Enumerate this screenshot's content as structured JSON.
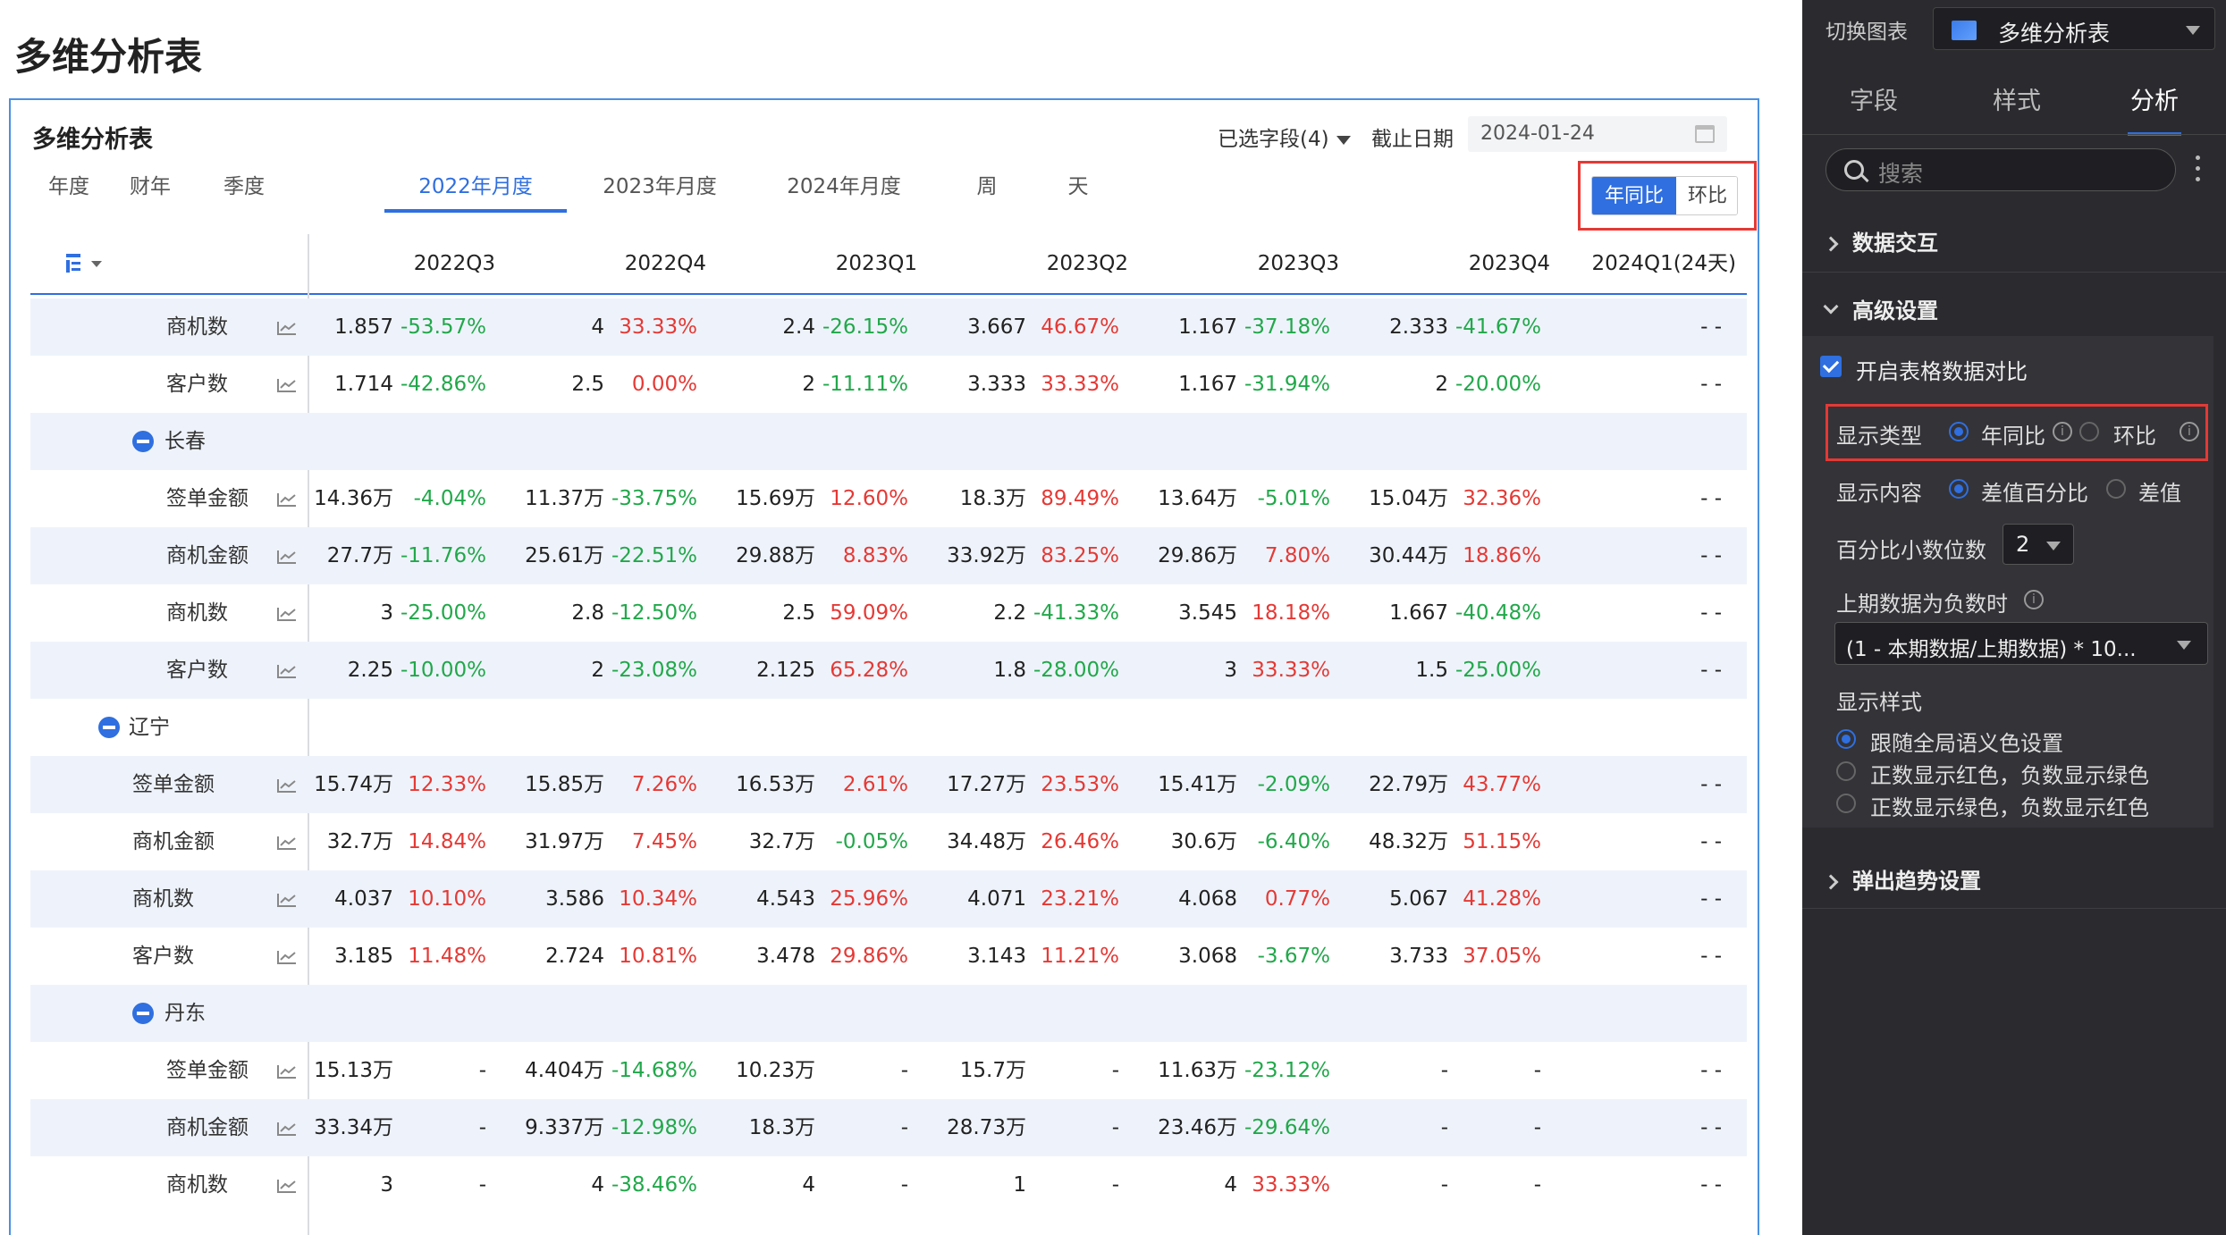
{
  "page_title": "多维分析表",
  "card": {
    "title": "多维分析表",
    "field_select": "已选字段(4)",
    "cutoff_label": "截止日期",
    "cutoff_date": "2024-01-24",
    "tabs": [
      "年度",
      "财年",
      "季度",
      "2022年月度",
      "2023年月度",
      "2024年月度",
      "周",
      "天"
    ],
    "active_tab": "2022年月度",
    "toggle": {
      "yoy": "年同比",
      "mom": "环比",
      "selected": "年同比"
    }
  },
  "table": {
    "columns": [
      "2022Q3",
      "2022Q4",
      "2023Q1",
      "2023Q2",
      "2023Q3",
      "2023Q4",
      "2024Q1(24天)"
    ],
    "rows": [
      {
        "kind": "metric",
        "indent": 1,
        "label": "商机数",
        "cells": [
          [
            "1.857",
            "-53.57%"
          ],
          [
            "4",
            "33.33%"
          ],
          [
            "2.4",
            "-26.15%"
          ],
          [
            "3.667",
            "46.67%"
          ],
          [
            "1.167",
            "-37.18%"
          ],
          [
            "2.333",
            "-41.67%"
          ],
          [
            "- -",
            ""
          ]
        ]
      },
      {
        "kind": "metric",
        "indent": 1,
        "label": "客户数",
        "cells": [
          [
            "1.714",
            "-42.86%"
          ],
          [
            "2.5",
            "0.00%"
          ],
          [
            "2",
            "-11.11%"
          ],
          [
            "3.333",
            "33.33%"
          ],
          [
            "1.167",
            "-31.94%"
          ],
          [
            "2",
            "-20.00%"
          ],
          [
            "- -",
            ""
          ]
        ]
      },
      {
        "kind": "group",
        "indent": 1,
        "label": "长春"
      },
      {
        "kind": "metric",
        "indent": 1,
        "label": "签单金额",
        "cells": [
          [
            "14.36万",
            "-4.04%"
          ],
          [
            "11.37万",
            "-33.75%"
          ],
          [
            "15.69万",
            "12.60%"
          ],
          [
            "18.3万",
            "89.49%"
          ],
          [
            "13.64万",
            "-5.01%"
          ],
          [
            "15.04万",
            "32.36%"
          ],
          [
            "- -",
            ""
          ]
        ]
      },
      {
        "kind": "metric",
        "indent": 1,
        "label": "商机金额",
        "cells": [
          [
            "27.7万",
            "-11.76%"
          ],
          [
            "25.61万",
            "-22.51%"
          ],
          [
            "29.88万",
            "8.83%"
          ],
          [
            "33.92万",
            "83.25%"
          ],
          [
            "29.86万",
            "7.80%"
          ],
          [
            "30.44万",
            "18.86%"
          ],
          [
            "- -",
            ""
          ]
        ]
      },
      {
        "kind": "metric",
        "indent": 1,
        "label": "商机数",
        "cells": [
          [
            "3",
            "-25.00%"
          ],
          [
            "2.8",
            "-12.50%"
          ],
          [
            "2.5",
            "59.09%"
          ],
          [
            "2.2",
            "-41.33%"
          ],
          [
            "3.545",
            "18.18%"
          ],
          [
            "1.667",
            "-40.48%"
          ],
          [
            "- -",
            ""
          ]
        ]
      },
      {
        "kind": "metric",
        "indent": 1,
        "label": "客户数",
        "cells": [
          [
            "2.25",
            "-10.00%"
          ],
          [
            "2",
            "-23.08%"
          ],
          [
            "2.125",
            "65.28%"
          ],
          [
            "1.8",
            "-28.00%"
          ],
          [
            "3",
            "33.33%"
          ],
          [
            "1.5",
            "-25.00%"
          ],
          [
            "- -",
            ""
          ]
        ]
      },
      {
        "kind": "group",
        "indent": 0,
        "label": "辽宁"
      },
      {
        "kind": "metric",
        "indent": 0,
        "label": "签单金额",
        "cells": [
          [
            "15.74万",
            "12.33%"
          ],
          [
            "15.85万",
            "7.26%"
          ],
          [
            "16.53万",
            "2.61%"
          ],
          [
            "17.27万",
            "23.53%"
          ],
          [
            "15.41万",
            "-2.09%"
          ],
          [
            "22.79万",
            "43.77%"
          ],
          [
            "- -",
            ""
          ]
        ]
      },
      {
        "kind": "metric",
        "indent": 0,
        "label": "商机金额",
        "cells": [
          [
            "32.7万",
            "14.84%"
          ],
          [
            "31.97万",
            "7.45%"
          ],
          [
            "32.7万",
            "-0.05%"
          ],
          [
            "34.48万",
            "26.46%"
          ],
          [
            "30.6万",
            "-6.40%"
          ],
          [
            "48.32万",
            "51.15%"
          ],
          [
            "- -",
            ""
          ]
        ]
      },
      {
        "kind": "metric",
        "indent": 0,
        "label": "商机数",
        "cells": [
          [
            "4.037",
            "10.10%"
          ],
          [
            "3.586",
            "10.34%"
          ],
          [
            "4.543",
            "25.96%"
          ],
          [
            "4.071",
            "23.21%"
          ],
          [
            "4.068",
            "0.77%"
          ],
          [
            "5.067",
            "41.28%"
          ],
          [
            "- -",
            ""
          ]
        ]
      },
      {
        "kind": "metric",
        "indent": 0,
        "label": "客户数",
        "cells": [
          [
            "3.185",
            "11.48%"
          ],
          [
            "2.724",
            "10.81%"
          ],
          [
            "3.478",
            "29.86%"
          ],
          [
            "3.143",
            "11.21%"
          ],
          [
            "3.068",
            "-3.67%"
          ],
          [
            "3.733",
            "37.05%"
          ],
          [
            "- -",
            ""
          ]
        ]
      },
      {
        "kind": "group",
        "indent": 1,
        "label": "丹东"
      },
      {
        "kind": "metric",
        "indent": 1,
        "label": "签单金额",
        "cells": [
          [
            "15.13万",
            "-"
          ],
          [
            "4.404万",
            "-14.68%"
          ],
          [
            "10.23万",
            "-"
          ],
          [
            "15.7万",
            "-"
          ],
          [
            "11.63万",
            "-23.12%"
          ],
          [
            "-",
            "-"
          ],
          [
            "- -",
            ""
          ]
        ]
      },
      {
        "kind": "metric",
        "indent": 1,
        "label": "商机金额",
        "cells": [
          [
            "33.34万",
            "-"
          ],
          [
            "9.337万",
            "-12.98%"
          ],
          [
            "18.3万",
            "-"
          ],
          [
            "28.73万",
            "-"
          ],
          [
            "23.46万",
            "-29.64%"
          ],
          [
            "-",
            "-"
          ],
          [
            "- -",
            ""
          ]
        ]
      },
      {
        "kind": "metric",
        "indent": 1,
        "label": "商机数",
        "cells": [
          [
            "3",
            "-"
          ],
          [
            "4",
            "-38.46%"
          ],
          [
            "4",
            "-"
          ],
          [
            "1",
            "-"
          ],
          [
            "4",
            "33.33%"
          ],
          [
            "-",
            "-"
          ],
          [
            "- -",
            ""
          ]
        ]
      }
    ],
    "colors": {
      "up": "#e53935",
      "down": "#21a84a",
      "accent": "#2f6fe0"
    }
  },
  "panel": {
    "switch_label": "切换图表",
    "chart_type": "多维分析表",
    "tabs": [
      "字段",
      "样式",
      "分析"
    ],
    "active_tab": "分析",
    "search_placeholder": "搜索",
    "sections": {
      "interaction": "数据交互",
      "advanced": "高级设置",
      "popup_trend": "弹出趋势设置"
    },
    "enable_compare": "开启表格数据对比",
    "display_type_label": "显示类型",
    "display_type_options": [
      "年同比",
      "环比"
    ],
    "display_type_selected": "年同比",
    "display_content_label": "显示内容",
    "display_content_options": [
      "差值百分比",
      "差值"
    ],
    "display_content_selected": "差值百分比",
    "decimals_label": "百分比小数位数",
    "decimals_value": "2",
    "negative_label": "上期数据为负数时",
    "negative_value": "(1 - 本期数据/上期数据) * 10...",
    "style_label": "显示样式",
    "style_options": [
      "跟随全局语义色设置",
      "正数显示红色，负数显示绿色",
      "正数显示绿色，负数显示红色"
    ],
    "style_selected": "跟随全局语义色设置"
  }
}
